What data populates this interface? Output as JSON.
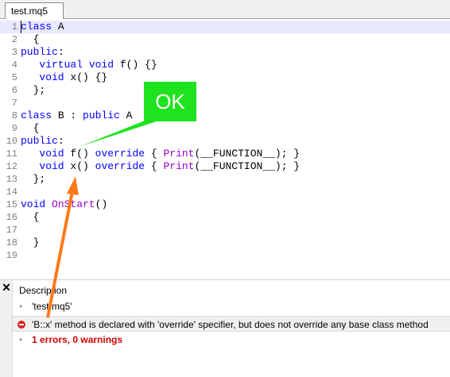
{
  "tab": {
    "label": "test.mq5"
  },
  "editor": {
    "lines": [
      {
        "n": "1",
        "segments": [
          [
            "kw",
            "class"
          ],
          [
            "",
            " A"
          ]
        ]
      },
      {
        "n": "2",
        "segments": [
          [
            "",
            "  {"
          ]
        ]
      },
      {
        "n": "3",
        "segments": [
          [
            "kw",
            "public"
          ],
          [
            "",
            ":"
          ]
        ]
      },
      {
        "n": "4",
        "segments": [
          [
            "",
            "   "
          ],
          [
            "kw",
            "virtual"
          ],
          [
            "",
            " "
          ],
          [
            "kw",
            "void"
          ],
          [
            "",
            " f() {}"
          ]
        ]
      },
      {
        "n": "5",
        "segments": [
          [
            "",
            "   "
          ],
          [
            "kw",
            "void"
          ],
          [
            "",
            " x() {}"
          ]
        ]
      },
      {
        "n": "6",
        "segments": [
          [
            "",
            "  };"
          ]
        ]
      },
      {
        "n": "7",
        "segments": []
      },
      {
        "n": "8",
        "segments": [
          [
            "kw",
            "class"
          ],
          [
            "",
            " B : "
          ],
          [
            "kw",
            "public"
          ],
          [
            "",
            " A"
          ]
        ]
      },
      {
        "n": "9",
        "segments": [
          [
            "",
            "  {"
          ]
        ]
      },
      {
        "n": "10",
        "segments": [
          [
            "kw",
            "public"
          ],
          [
            "",
            ":"
          ]
        ]
      },
      {
        "n": "11",
        "segments": [
          [
            "",
            "   "
          ],
          [
            "kw",
            "void"
          ],
          [
            "",
            " f() "
          ],
          [
            "kw",
            "override"
          ],
          [
            "",
            " { "
          ],
          [
            "fn",
            "Print"
          ],
          [
            "",
            "(__FUNCTION__); }"
          ]
        ]
      },
      {
        "n": "12",
        "segments": [
          [
            "",
            "   "
          ],
          [
            "kw",
            "void"
          ],
          [
            "",
            " x() "
          ],
          [
            "kw",
            "override"
          ],
          [
            "",
            " { "
          ],
          [
            "fn",
            "Print"
          ],
          [
            "",
            "(__FUNCTION__); }"
          ]
        ]
      },
      {
        "n": "13",
        "segments": [
          [
            "",
            "  };"
          ]
        ]
      },
      {
        "n": "14",
        "segments": []
      },
      {
        "n": "15",
        "segments": [
          [
            "kw",
            "void"
          ],
          [
            "",
            " "
          ],
          [
            "fn",
            "OnStart"
          ],
          [
            "",
            "()"
          ]
        ]
      },
      {
        "n": "16",
        "segments": [
          [
            "",
            "  {"
          ]
        ]
      },
      {
        "n": "17",
        "segments": []
      },
      {
        "n": "18",
        "segments": [
          [
            "",
            "  }"
          ]
        ]
      },
      {
        "n": "19",
        "segments": []
      }
    ]
  },
  "annotation": {
    "ok_label": "OK"
  },
  "panel": {
    "header": "Description",
    "messages": [
      {
        "type": "info",
        "text": "'test.mq5'"
      },
      {
        "type": "error",
        "text": "'B::x' method is declared with 'override' specifier, but does not override any base class method"
      },
      {
        "type": "summary",
        "text": "1 errors, 0 warnings"
      }
    ]
  },
  "colors": {
    "keyword": "#0000ff",
    "function": "#9900cc",
    "ok_box": "#1fe31f",
    "arrow": "#ff7a1a",
    "error_text": "#d00000"
  },
  "icons": {
    "close": "close-icon",
    "error": "error-icon",
    "bullet": "bullet-icon"
  }
}
